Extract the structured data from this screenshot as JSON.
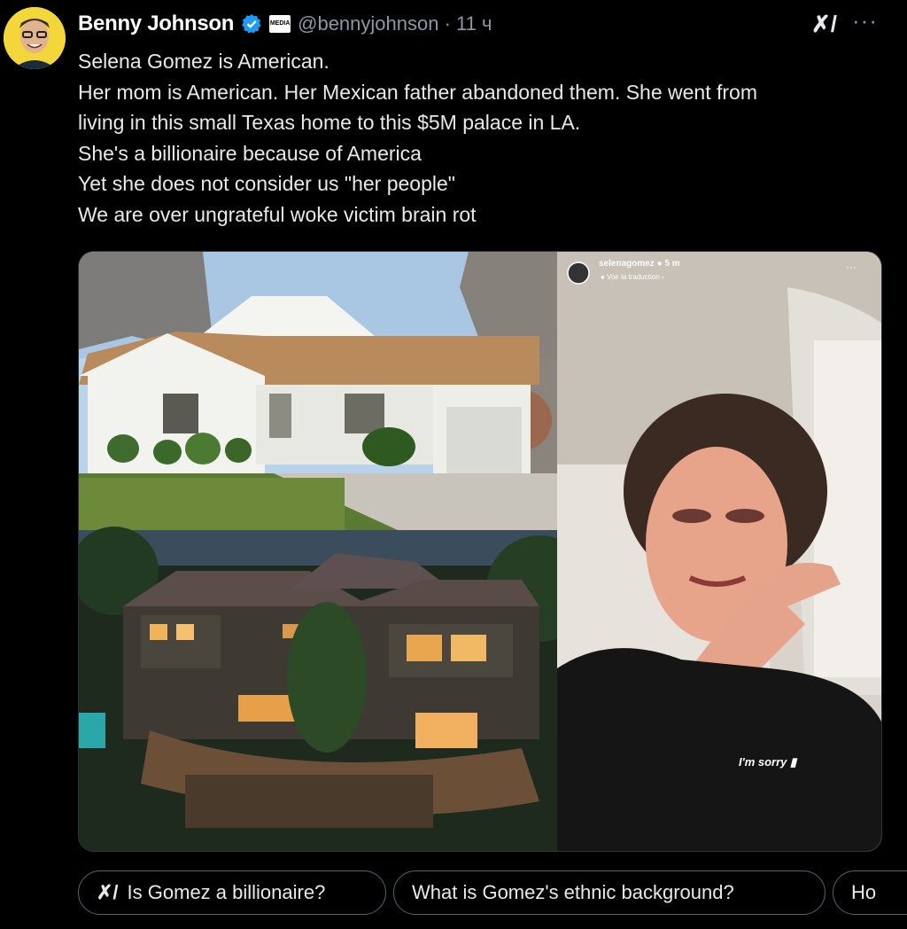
{
  "post": {
    "author_name": "Benny Johnson",
    "badge_text": "MEDIA",
    "handle_time": "@bennyjohnson · 11 ч",
    "grok_icon": "grok-icon",
    "more_icon": "more-icon",
    "text_lines": [
      "Selena Gomez is American.",
      "Her mom is American. Her Mexican father abandoned them. She went from",
      "living in this small Texas home to this $5M palace in LA.",
      "She's a billionaire because of America",
      "Yet she does not consider us \"her people\"",
      "We are over ungrateful woke victim brain rot"
    ]
  },
  "story": {
    "username": "selenagomez ● 5 m",
    "translate": "● Voir la traduction ›",
    "more": "···",
    "sticker": "I'm sorry ▮"
  },
  "suggestions": [
    "Is Gomez a billionaire?",
    "What is Gomez's ethnic background?",
    "Ho"
  ],
  "colors": {
    "background": "#000000",
    "verified": "#1d9bf0",
    "avatar_bg": "#f2d63a"
  }
}
